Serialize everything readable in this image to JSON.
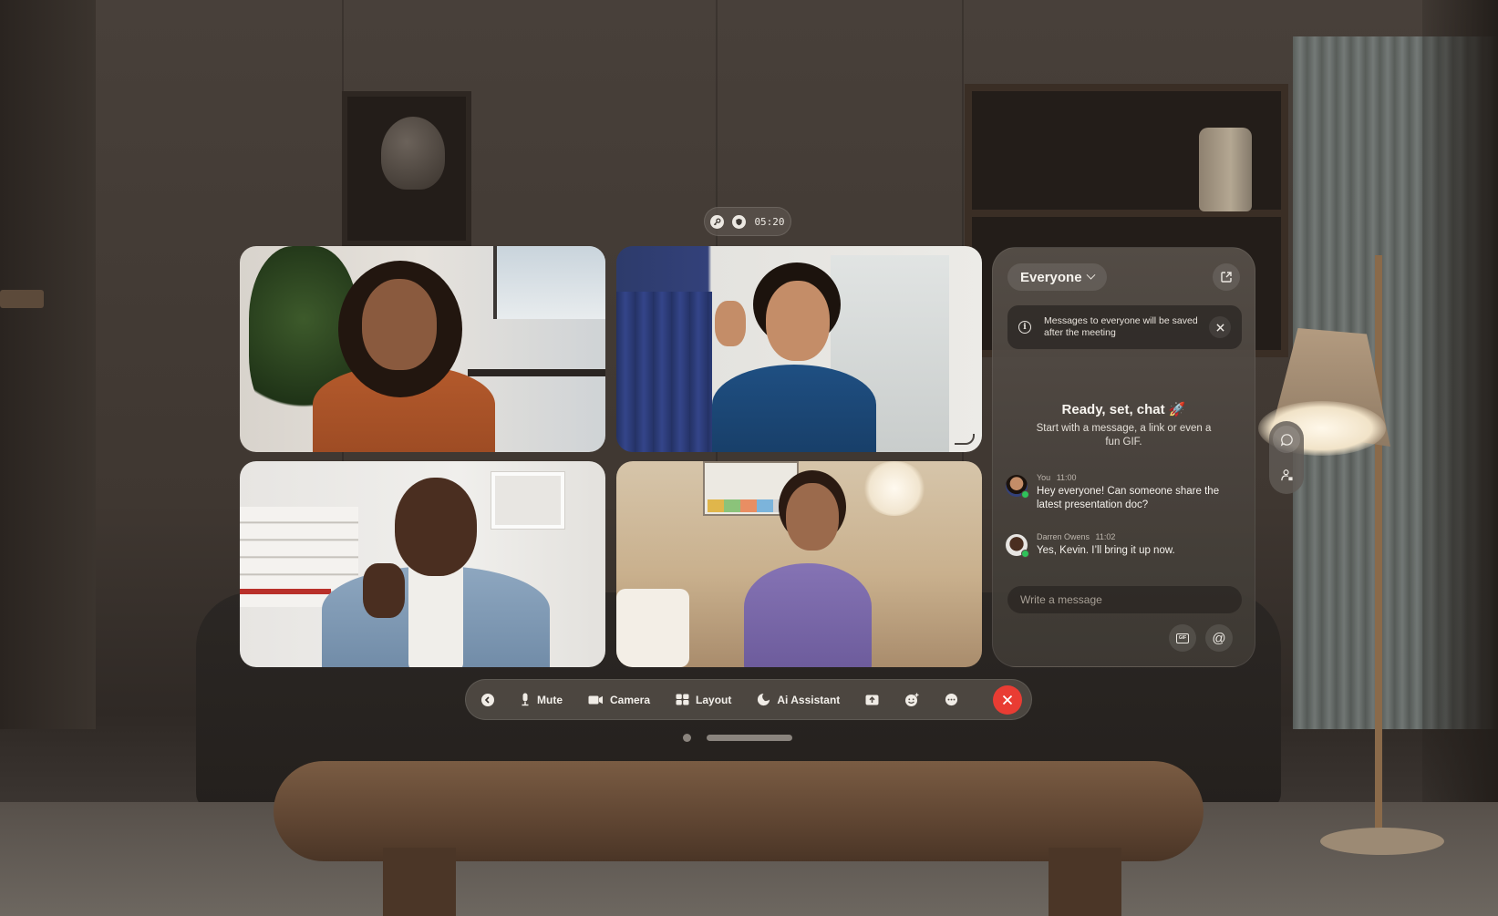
{
  "timer": {
    "elapsed": "05:20",
    "icons": [
      "key-icon",
      "shield-icon"
    ]
  },
  "participants": [
    {
      "tile": 1,
      "description": "Woman in orange shirt smiling, hands clasped"
    },
    {
      "tile": 2,
      "description": "Doctor in blue scrubs waving"
    },
    {
      "tile": 3,
      "description": "Man in denim shirt giving thumbs up"
    },
    {
      "tile": 4,
      "description": "Woman in purple jacket sitting in bedroom"
    }
  ],
  "chat": {
    "audience": "Everyone",
    "notice": "Messages to everyone will be saved after the meeting",
    "empty_title": "Ready, set, chat 🚀",
    "empty_subtitle": "Start with a message, a link or even a fun GIF.",
    "messages": [
      {
        "sender": "You",
        "time": "11:00",
        "text": "Hey everyone! Can someone share the latest presentation doc?",
        "online": true
      },
      {
        "sender": "Darren Owens",
        "time": "11:02",
        "text": "Yes, Kevin. I’ll bring it up now.",
        "online": true
      }
    ],
    "compose_placeholder": "Write a message",
    "compose_value": "",
    "gif_label": "GIF",
    "mention_symbol": "@"
  },
  "side_rail": {
    "items": [
      {
        "name": "chat",
        "icon": "chat-bubble-icon",
        "active": true
      },
      {
        "name": "participants",
        "icon": "people-icon",
        "active": false
      }
    ]
  },
  "toolbar": {
    "back_icon": "chevron-left-icon",
    "mute_label": "Mute",
    "camera_label": "Camera",
    "layout_label": "Layout",
    "ai_label": "Ai Assistant",
    "share_icon": "share-screen-icon",
    "reactions_icon": "emoji-add-icon",
    "more_icon": "more-icon",
    "end_icon": "close-icon",
    "end_color": "#e93c33"
  },
  "pager": {
    "pages": 2,
    "current": 1
  }
}
